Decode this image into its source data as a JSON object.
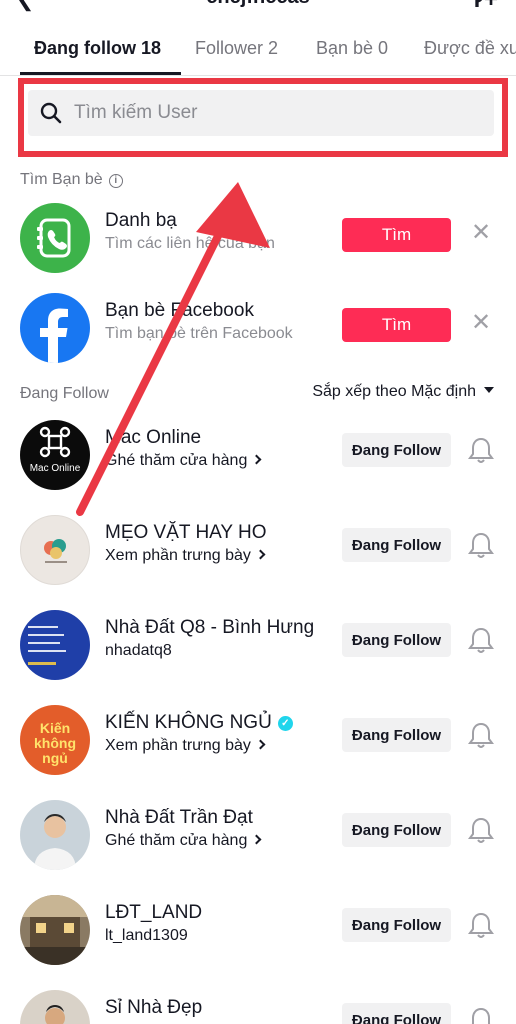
{
  "header": {
    "title": "chejfhccas",
    "back_icon": "chevron-left-icon",
    "add_icon": "add-user-icon"
  },
  "tabs": [
    {
      "label": "Đang follow 18",
      "active": true
    },
    {
      "label": "Follower 2",
      "active": false
    },
    {
      "label": "Bạn bè 0",
      "active": false
    },
    {
      "label": "Được đề xu",
      "active": false
    }
  ],
  "search": {
    "placeholder": "Tìm kiếm User",
    "value": ""
  },
  "find_friends": {
    "label": "Tìm Bạn bè",
    "items": [
      {
        "name": "Danh bạ",
        "sub": "Tìm các liên hệ của bạn",
        "button": "Tìm",
        "icon": "phone-contacts-icon",
        "color": "#3db34a"
      },
      {
        "name": "Bạn bè Facebook",
        "sub": "Tìm bạn bè trên Facebook",
        "button": "Tìm",
        "icon": "facebook-icon",
        "color": "#1877f2"
      }
    ]
  },
  "following": {
    "label": "Đang Follow",
    "sort_label": "Sắp xếp theo Mặc định",
    "button_label": "Đang Follow",
    "users": [
      {
        "name": "Mac Online",
        "sub": "Ghé thăm cửa hàng",
        "sub_link": true,
        "verified": false,
        "avatar_text": "Mac Online"
      },
      {
        "name": "MẸO VẶT HAY HO",
        "sub": "Xem phần trưng bày",
        "sub_link": true,
        "verified": false,
        "avatar_text": ""
      },
      {
        "name": "Nhà Đất Q8 - Bình Hưng",
        "sub": "nhadatq8",
        "sub_link": false,
        "verified": false,
        "avatar_text": ""
      },
      {
        "name": "KIẾN KHÔNG NGỦ",
        "sub": "Xem phần trưng bày",
        "sub_link": true,
        "verified": true,
        "avatar_text": "Kiến không ngủ"
      },
      {
        "name": "Nhà Đất Trần Đạt",
        "sub": "Ghé thăm cửa hàng",
        "sub_link": true,
        "verified": false,
        "avatar_text": ""
      },
      {
        "name": "LĐT_LAND",
        "sub": "lt_land1309",
        "sub_link": false,
        "verified": false,
        "avatar_text": ""
      },
      {
        "name": "Sỉ Nhà Đẹp",
        "sub": "",
        "sub_link": false,
        "verified": false,
        "avatar_text": ""
      }
    ]
  },
  "colors": {
    "accent_red": "#fe2c55",
    "annotation_red": "#ea3844",
    "verified_blue": "#20d5ec"
  }
}
